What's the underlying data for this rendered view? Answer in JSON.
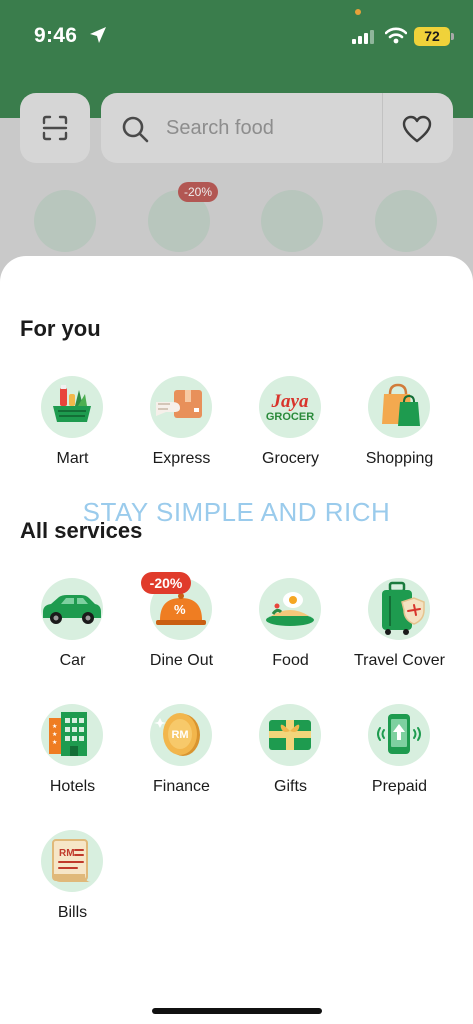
{
  "status_bar": {
    "time": "9:46",
    "battery": "72",
    "location_icon": "location-arrow-icon",
    "signal_icon": "cellular-signal-icon",
    "wifi_icon": "wifi-icon"
  },
  "search": {
    "placeholder": "Search food",
    "scan_icon": "scan-icon",
    "search_icon": "search-icon",
    "favorite_icon": "heart-icon"
  },
  "background_row": {
    "badge": "-20%"
  },
  "watermark": "STAY SIMPLE AND RICH",
  "for_you": {
    "title": "For you",
    "items": [
      {
        "label": "Mart",
        "icon": "mart-basket-icon"
      },
      {
        "label": "Express",
        "icon": "express-parcel-icon"
      },
      {
        "label": "Grocery",
        "icon": "jaya-grocer-icon",
        "logo_text_1": "Jaya",
        "logo_text_2": "GROCER"
      },
      {
        "label": "Shopping",
        "icon": "shopping-bag-icon"
      }
    ]
  },
  "all_services": {
    "title": "All services",
    "items": [
      {
        "label": "Car",
        "icon": "car-icon"
      },
      {
        "label": "Dine Out",
        "icon": "dine-out-icon",
        "badge": "-20%"
      },
      {
        "label": "Food",
        "icon": "food-plate-icon"
      },
      {
        "label": "Travel Cover",
        "icon": "travel-luggage-icon"
      },
      {
        "label": "Hotels",
        "icon": "hotel-building-icon"
      },
      {
        "label": "Finance",
        "icon": "finance-coin-icon",
        "coin_text": "RM"
      },
      {
        "label": "Gifts",
        "icon": "gift-card-icon"
      },
      {
        "label": "Prepaid",
        "icon": "prepaid-phone-icon"
      },
      {
        "label": "Bills",
        "icon": "bill-receipt-icon",
        "bill_text": "RM"
      }
    ]
  },
  "colors": {
    "brand_green": "#3a7d4c",
    "icon_bg": "#d8efdf",
    "badge_red": "#e03b2b"
  }
}
